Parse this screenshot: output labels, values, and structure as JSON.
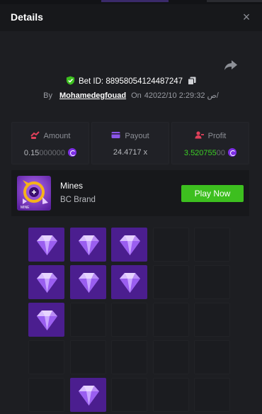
{
  "header": {
    "title": "Details",
    "close_label": "×"
  },
  "bet": {
    "label": "Bet ID:",
    "id": "88958054124487247"
  },
  "byline": {
    "by": "By",
    "username": "Mohamedegfouad",
    "on": "On",
    "datetime": "4ص 2:29:32 2022/10/"
  },
  "stats": {
    "amount": {
      "label": "Amount",
      "value_main": "0.15",
      "value_dim": "000000"
    },
    "payout": {
      "label": "Payout",
      "value": "24.4717 x"
    },
    "profit": {
      "label": "Profit",
      "value_main": "3.520755",
      "value_dim": "00"
    }
  },
  "game": {
    "name": "Mines",
    "brand": "BC Brand",
    "play_label": "Play Now",
    "thumb_label": "MINE"
  },
  "grid": {
    "columns": 5,
    "visible_rows": 5,
    "gems": [
      [
        1,
        1,
        1,
        0,
        0
      ],
      [
        1,
        1,
        1,
        0,
        0
      ],
      [
        1,
        0,
        0,
        0,
        0
      ],
      [
        0,
        0,
        0,
        0,
        0
      ],
      [
        0,
        1,
        0,
        0,
        0
      ]
    ]
  },
  "colors": {
    "accent_green": "#3dbf1f",
    "gem_bg": "#4b1e8f",
    "profit_green": "#3ccf25",
    "coin": "#7d2ee6"
  },
  "icons": {
    "close": "close-icon",
    "share": "share-icon",
    "verified": "shield-check-icon",
    "copy": "copy-icon",
    "amount": "coins-icon",
    "payout": "wallet-icon",
    "profit": "user-profit-icon",
    "coin": "bc-coin-icon"
  }
}
